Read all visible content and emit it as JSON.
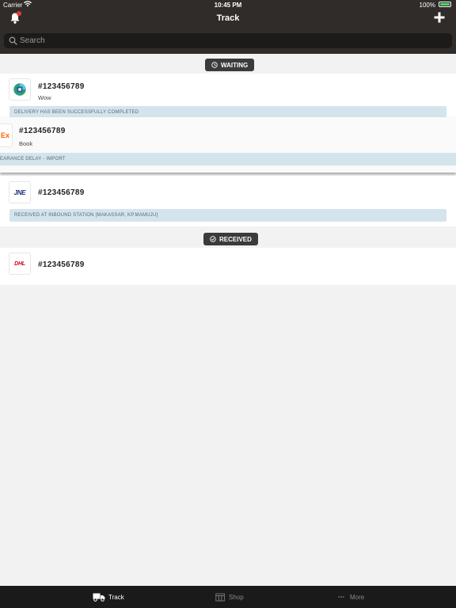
{
  "status_bar": {
    "carrier": "Carrier",
    "time": "10:45 PM",
    "battery": "100%"
  },
  "nav": {
    "title": "Track",
    "bell_icon": "bell-icon",
    "add_icon": "plus-icon",
    "has_notification": true
  },
  "search": {
    "placeholder": "Search",
    "value": ""
  },
  "sections": {
    "waiting": "WAITING",
    "received": "RECEIVED"
  },
  "shipments": [
    {
      "courier_logo": "generic-courier-logo",
      "tracking": "#123456789",
      "note": "Wow",
      "status": "DELIVERY HAS BEEN SUCCESSFULLY COMPLETED"
    },
    {
      "courier_logo": "fedex-logo",
      "logo_text": "Ex",
      "tracking": "#123456789",
      "note": "Book",
      "status": "EARANCE DELAY - IMPORT"
    },
    {
      "courier_logo": "jne-logo",
      "logo_text": "JNE",
      "tracking": "#123456789",
      "note": "",
      "status": "RECEIVED AT INBOUND STATION [MAKASSAR, KP.MAMUJU]"
    },
    {
      "courier_logo": "dhl-logo",
      "logo_text": "DHL",
      "tracking": "#123456789",
      "note": ""
    }
  ],
  "tabs": [
    {
      "label": "Track",
      "icon": "truck-icon",
      "active": true
    },
    {
      "label": "Shop",
      "icon": "shop-icon",
      "active": false
    },
    {
      "label": "More",
      "icon": "more-icon",
      "active": false
    }
  ],
  "colors": {
    "chrome": "#2f2c2a",
    "status_band": "#d4e4ed",
    "tab_active": "#ffffff",
    "tab_inactive": "#8a8a8a",
    "notification_dot": "#e53935"
  }
}
